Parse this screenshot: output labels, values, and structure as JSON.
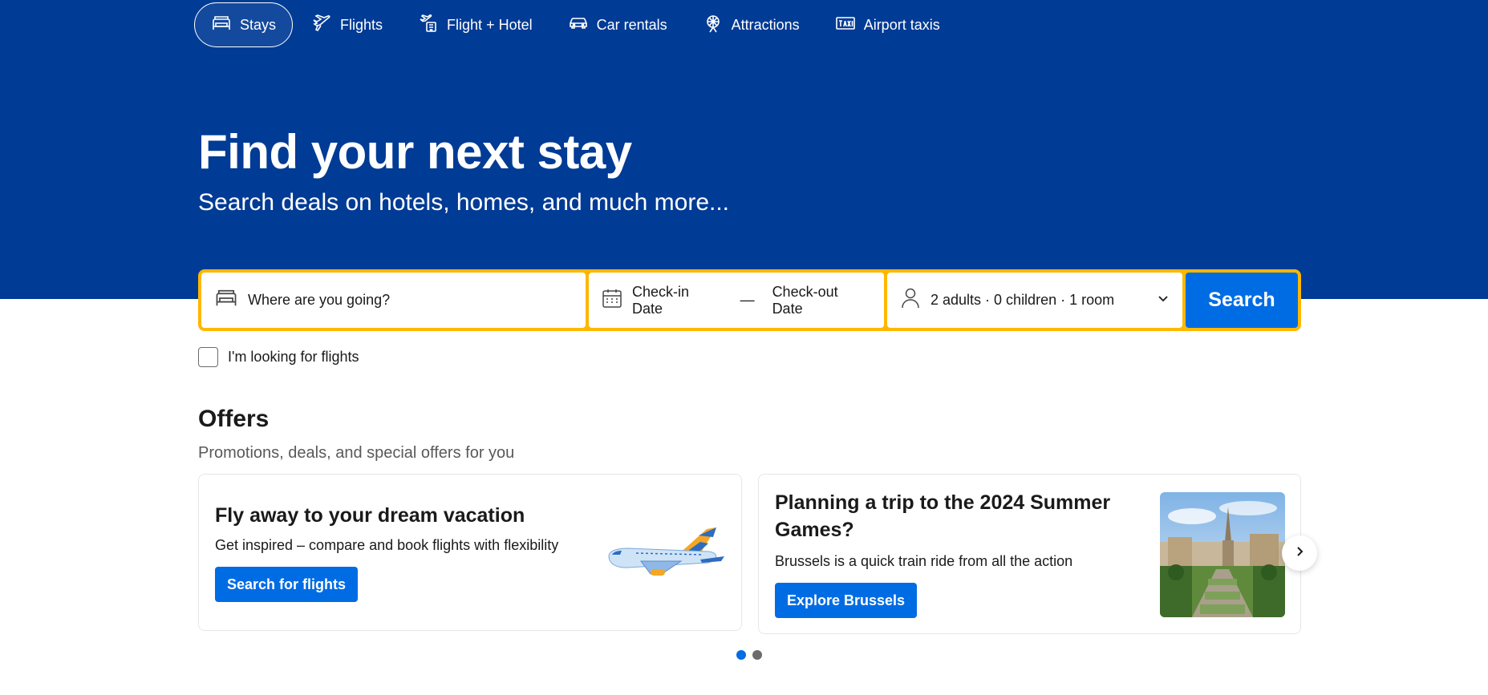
{
  "colors": {
    "brand_blue": "#003b95",
    "action_blue": "#006ce4",
    "search_border": "#ffb700"
  },
  "nav": {
    "items": [
      {
        "label": "Stays",
        "icon": "bed-icon",
        "active": true
      },
      {
        "label": "Flights",
        "icon": "plane-icon",
        "active": false
      },
      {
        "label": "Flight + Hotel",
        "icon": "plane-hotel-icon",
        "active": false
      },
      {
        "label": "Car rentals",
        "icon": "car-icon",
        "active": false
      },
      {
        "label": "Attractions",
        "icon": "ferris-wheel-icon",
        "active": false
      },
      {
        "label": "Airport taxis",
        "icon": "taxi-icon",
        "active": false
      }
    ]
  },
  "hero": {
    "title": "Find your next stay",
    "subtitle": "Search deals on hotels, homes, and much more..."
  },
  "search": {
    "destination_placeholder": "Where are you going?",
    "checkin_label": "Check-in Date",
    "date_separator": "—",
    "checkout_label": "Check-out Date",
    "guests_label": "2 adults · 0 children · 1 room",
    "button_label": "Search"
  },
  "flights_checkbox": {
    "label": "I'm looking for flights",
    "checked": false
  },
  "offers": {
    "title": "Offers",
    "subtitle": "Promotions, deals, and special offers for you",
    "cards": [
      {
        "title": "Fly away to your dream vacation",
        "text": "Get inspired – compare and book flights with flexibility",
        "button": "Search for flights"
      },
      {
        "title": "Planning a trip to the 2024 Summer Games?",
        "text": "Brussels is a quick train ride from all the action",
        "button": "Explore Brussels"
      }
    ],
    "carousel_pages": 2,
    "active_page": 1
  }
}
